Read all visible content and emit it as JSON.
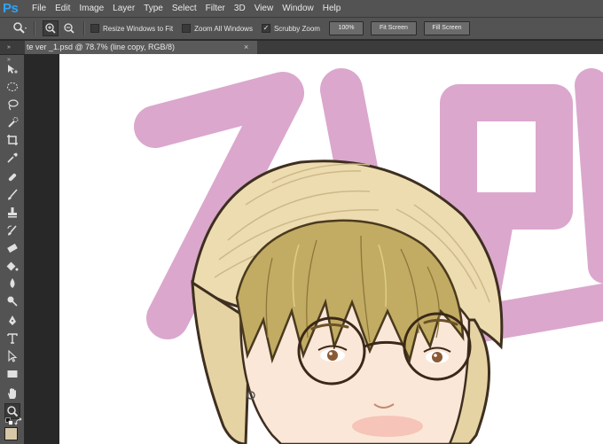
{
  "app": {
    "logo": "Ps"
  },
  "menu": [
    "File",
    "Edit",
    "Image",
    "Layer",
    "Type",
    "Select",
    "Filter",
    "3D",
    "View",
    "Window",
    "Help"
  ],
  "options": {
    "resize_windows": {
      "label": "Resize Windows to Fit",
      "checked": false
    },
    "zoom_all": {
      "label": "Zoom All Windows",
      "checked": false
    },
    "scrubby_zoom": {
      "label": "Scrubby Zoom",
      "checked": true
    },
    "btn_100": "100%",
    "btn_fit": "Fit Screen",
    "btn_fill": "Fill Screen"
  },
  "document": {
    "tab_title": "te ver _1.psd @ 78.7% (line copy, RGB/8)",
    "close_glyph": "×"
  },
  "colors": {
    "ui_gray": "#535353",
    "canvas_bg": "#282828",
    "ps_blue": "#2fa3f6",
    "pink_lettering": "#dba7cd",
    "hat": "#eddcb0",
    "hair": "#c2ac63",
    "skin": "#fbe7d8",
    "foreground_swatch": "#d8c8a8"
  }
}
